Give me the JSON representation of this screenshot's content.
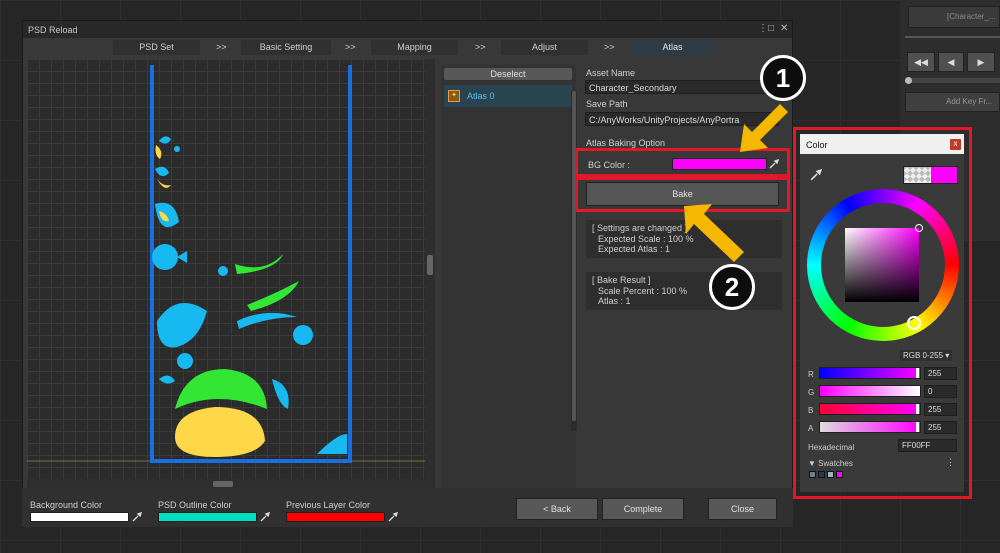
{
  "background": {
    "field_text": "[Character_...",
    "button_text": "Add Key Fr..."
  },
  "window": {
    "title": "PSD Reload",
    "controls": {
      "menu": "⋮",
      "maximize": "□",
      "close": "✕"
    },
    "tabs": [
      {
        "label": "PSD Set"
      },
      {
        "label": "Basic Setting"
      },
      {
        "label": "Mapping"
      },
      {
        "label": "Adjust"
      },
      {
        "label": "Atlas",
        "active": true
      }
    ],
    "tab_separator": ">>"
  },
  "atlas_list": {
    "deselect_label": "Deselect",
    "items": [
      {
        "label": "Atlas 0"
      }
    ]
  },
  "settings": {
    "asset_name_label": "Asset Name",
    "asset_name_value": "Character_Secondary",
    "save_path_label": "Save Path",
    "save_path_value": "C:/AnyWorks/UnityProjects/AnyPortra",
    "baking_option_label": "Atlas Baking Option",
    "bg_color_label": "BG Color :",
    "bg_color": "#FF00FF",
    "bake_label": "Bake",
    "settings_changed": {
      "line1": "[ Settings are changed ]",
      "line2": "Expected Scale : 100 %",
      "line3": "Expected Atlas : 1"
    },
    "bake_result": {
      "line1": "[ Bake Result ]",
      "line2": "Scale Percent : 100 %",
      "line3": "Atlas : 1"
    }
  },
  "bottom": {
    "background_color_label": "Background Color",
    "background_color": "#FFFFFF",
    "psd_outline_label": "PSD Outline Color",
    "psd_outline_color": "#00E0C0",
    "previous_layer_label": "Previous Layer Color",
    "previous_layer_color": "#FF0000",
    "back_label": "< Back",
    "complete_label": "Complete",
    "close_label": "Close"
  },
  "callouts": {
    "one": "1",
    "two": "2"
  },
  "color_picker": {
    "title": "Color",
    "close": "x",
    "mode": "RGB 0-255 ▾",
    "channels": [
      {
        "label": "R",
        "value": "255"
      },
      {
        "label": "G",
        "value": "0"
      },
      {
        "label": "B",
        "value": "255"
      },
      {
        "label": "A",
        "value": "255"
      }
    ],
    "hex_label": "Hexadecimal",
    "hex_value": "FF00FF",
    "swatches_label": "▼ Swatches",
    "swatches_menu": "⋮",
    "swatches": [
      "#6c7f8a",
      "#2a3a4a",
      "#8fb7c8",
      "#ff00ff"
    ]
  },
  "colors": {
    "highlight": "#E3172A",
    "arrow": "#F5B800",
    "shape_blue": "#18B8F0",
    "shape_green": "#33E633",
    "shape_yellow": "#FFD84A"
  }
}
